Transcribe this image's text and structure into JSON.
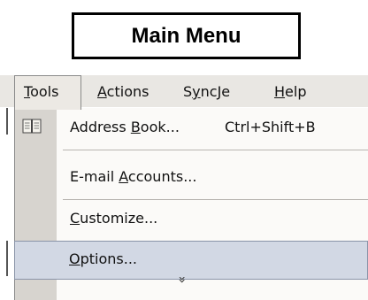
{
  "title": "Main Menu",
  "menubar": {
    "items": [
      {
        "label": "Tools",
        "accel": "T",
        "rest": "ools"
      },
      {
        "label": "Actions",
        "accel": "A",
        "rest": "ctions"
      },
      {
        "label": "SyncJe",
        "pre": "S",
        "accel": "y",
        "rest": "ncJe"
      },
      {
        "label": "Help",
        "accel": "H",
        "rest": "elp"
      }
    ]
  },
  "dropdown": {
    "items": [
      {
        "label": "Address Book...",
        "pre": "Address ",
        "accel": "B",
        "rest": "ook...",
        "shortcut": "Ctrl+Shift+B",
        "icon": "address-book-icon"
      },
      {
        "label": "E-mail Accounts...",
        "pre": "E-mail ",
        "accel": "A",
        "rest": "ccounts..."
      },
      {
        "label": "Customize...",
        "accel": "C",
        "rest": "ustomize..."
      },
      {
        "label": "Options...",
        "accel": "O",
        "rest": "ptions...",
        "highlighted": true
      }
    ],
    "expand_icon": "double-chevron-down-icon",
    "expand_glyph": "»"
  },
  "colors": {
    "menubar_bg": "#e9e7e3",
    "gutter_bg": "#d7d4cf",
    "highlight_bg": "#d2d8e4",
    "highlight_border": "#8a94a8"
  }
}
